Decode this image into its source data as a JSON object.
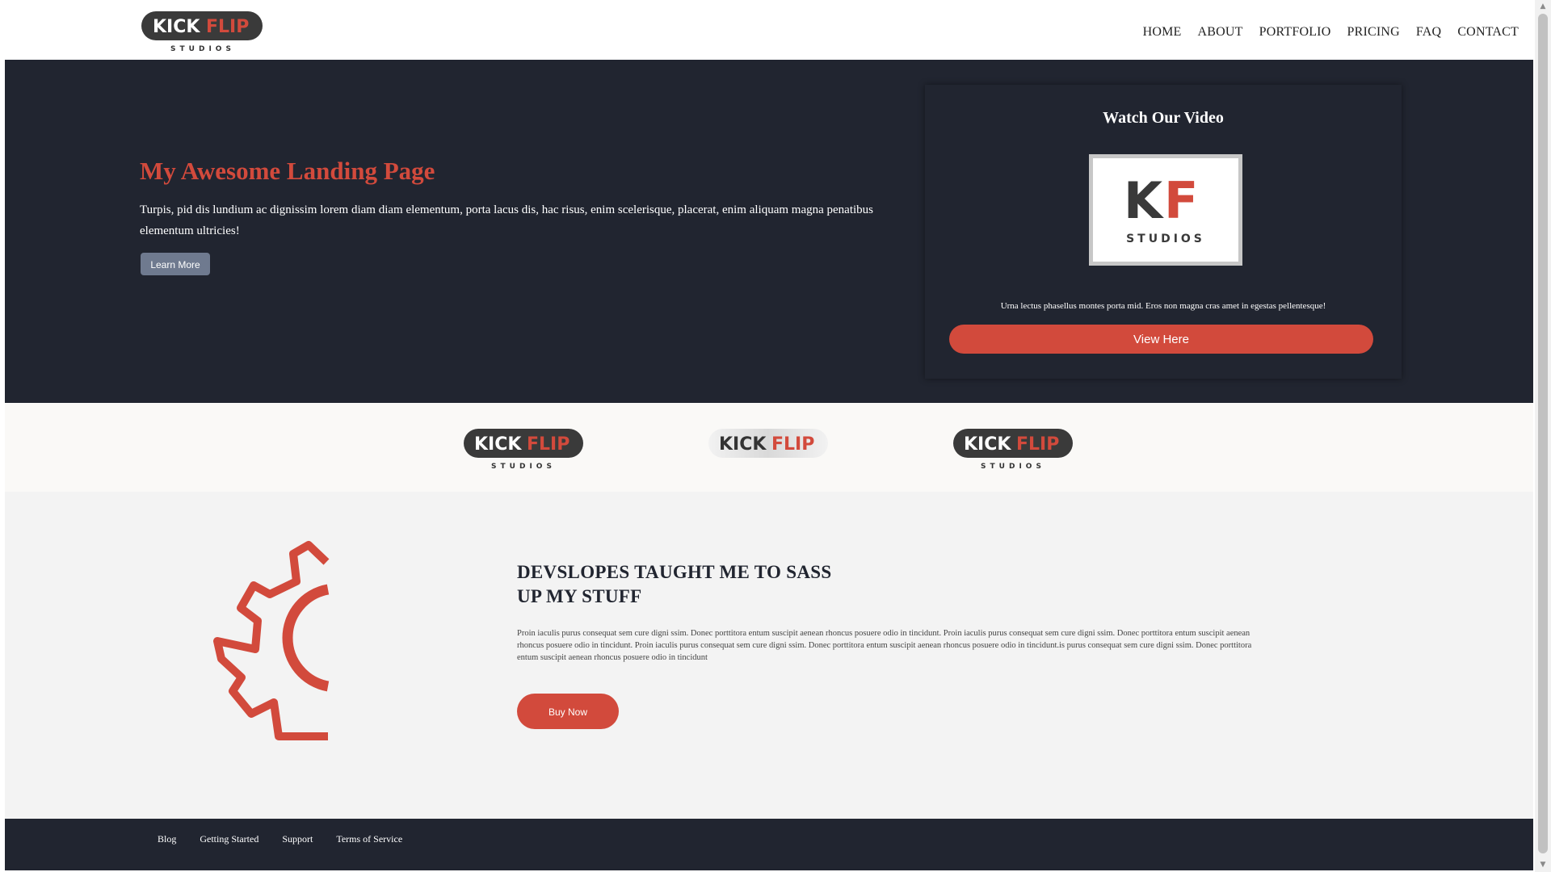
{
  "header": {
    "logo": {
      "word_left": "KICK",
      "word_right": "FLIP",
      "subtitle": "STUDIOS"
    },
    "nav": [
      "HOME",
      "ABOUT",
      "PORTFOLIO",
      "PRICING",
      "FAQ",
      "CONTACT"
    ]
  },
  "hero": {
    "title": "My Awesome Landing Page",
    "text": "Turpis, pid dis lundium ac dignissim lorem diam diam elementum, porta lacus dis, hac risus, enim scelerisque, placerat, enim aliquam magna penatibus elementum ultricies!",
    "button": "Learn More",
    "video_card": {
      "title": "Watch Our Video",
      "thumb": {
        "mark_left": "K",
        "mark_right": "F",
        "subtitle": "STUDIOS"
      },
      "text": "Urna lectus phasellus montes porta mid. Eros non magna cras amet in egestas pellentesque!",
      "button": "View Here"
    }
  },
  "logo_strip": {
    "logos": [
      {
        "word_left": "KICK",
        "word_right": "FLIP",
        "subtitle": "STUDIOS"
      },
      {
        "word_left": "KICK",
        "word_right": "FLIP",
        "subtitle": ""
      },
      {
        "word_left": "KICK",
        "word_right": "FLIP",
        "subtitle": "STUDIOS"
      }
    ]
  },
  "feature": {
    "title_line1": "DEVSLOPES TAUGHT ME TO SASS",
    "title_line2": "UP MY STUFF",
    "text": "Proin iaculis purus consequat sem cure digni ssim. Donec porttitora entum suscipit aenean rhoncus posuere odio in tincidunt. Proin iaculis purus consequat sem cure digni ssim. Donec porttitora entum suscipit aenean rhoncus posuere odio in tincidunt. Proin iaculis purus consequat sem cure digni ssim. Donec porttitora entum suscipit aenean rhoncus posuere odio in tincidunt.is purus consequat sem cure digni ssim. Donec porttitora entum suscipit aenean rhoncus posuere odio in tincidunt",
    "button": "Buy Now"
  },
  "footer": {
    "links": [
      "Blog",
      "Getting Started",
      "Support",
      "Terms of Service"
    ]
  },
  "colors": {
    "accent": "#d24a3c",
    "dark": "#212530",
    "button_gray": "#6f7a8f",
    "light_bg": "#f3f3f3",
    "strip_bg": "#faf9f7"
  },
  "icons": {
    "gear": "gear-icon",
    "scroll_up": "scroll-up-arrow-icon",
    "scroll_down": "scroll-down-arrow-icon"
  }
}
